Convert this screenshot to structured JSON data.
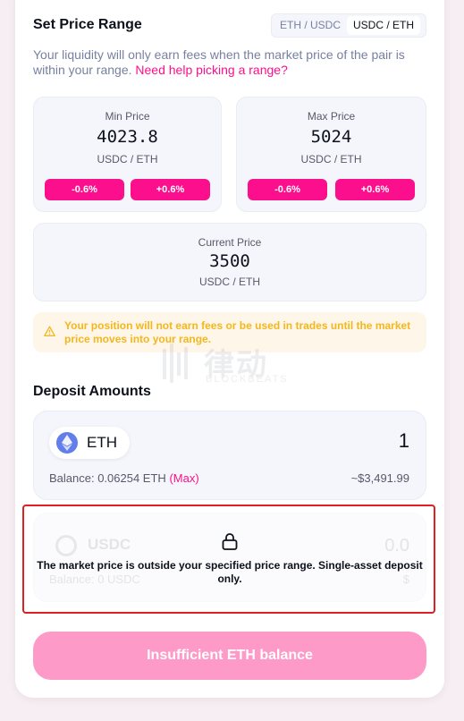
{
  "header": {
    "title": "Set Price Range",
    "toggle": [
      "ETH / USDC",
      "USDC / ETH"
    ]
  },
  "description": {
    "text": "Your liquidity will only earn fees when the market price of the pair is within your range.",
    "link": "Need help picking a range?"
  },
  "min_price": {
    "label": "Min Price",
    "value": "4023.8",
    "unit": "USDC / ETH",
    "dec": "-0.6%",
    "inc": "+0.6%"
  },
  "max_price": {
    "label": "Max Price",
    "value": "5024",
    "unit": "USDC / ETH",
    "dec": "-0.6%",
    "inc": "+0.6%"
  },
  "current_price": {
    "label": "Current Price",
    "value": "3500",
    "unit": "USDC / ETH"
  },
  "warning": {
    "text": "Your position will not earn fees or be used in trades until the market price moves into your range."
  },
  "watermark": {
    "cn": "律动",
    "en": "BLOCKBEATS"
  },
  "deposit": {
    "title": "Deposit Amounts",
    "eth": {
      "symbol": "ETH",
      "amount": "1",
      "balance": "Balance: 0.06254 ETH",
      "max": "(Max)",
      "usd": "~$3,491.99"
    },
    "usdc": {
      "symbol": "USDC",
      "amount": "0.0",
      "balance": "Balance: 0 USDC",
      "usd": "$"
    },
    "locked_message": "The market price is outside your specified price range. Single-asset deposit only."
  },
  "submit": {
    "label": "Insufficient ETH balance"
  },
  "colors": {
    "accent": "#fc0f8c",
    "warning": "#f3b71e",
    "submit_disabled": "#fd9ac8"
  }
}
